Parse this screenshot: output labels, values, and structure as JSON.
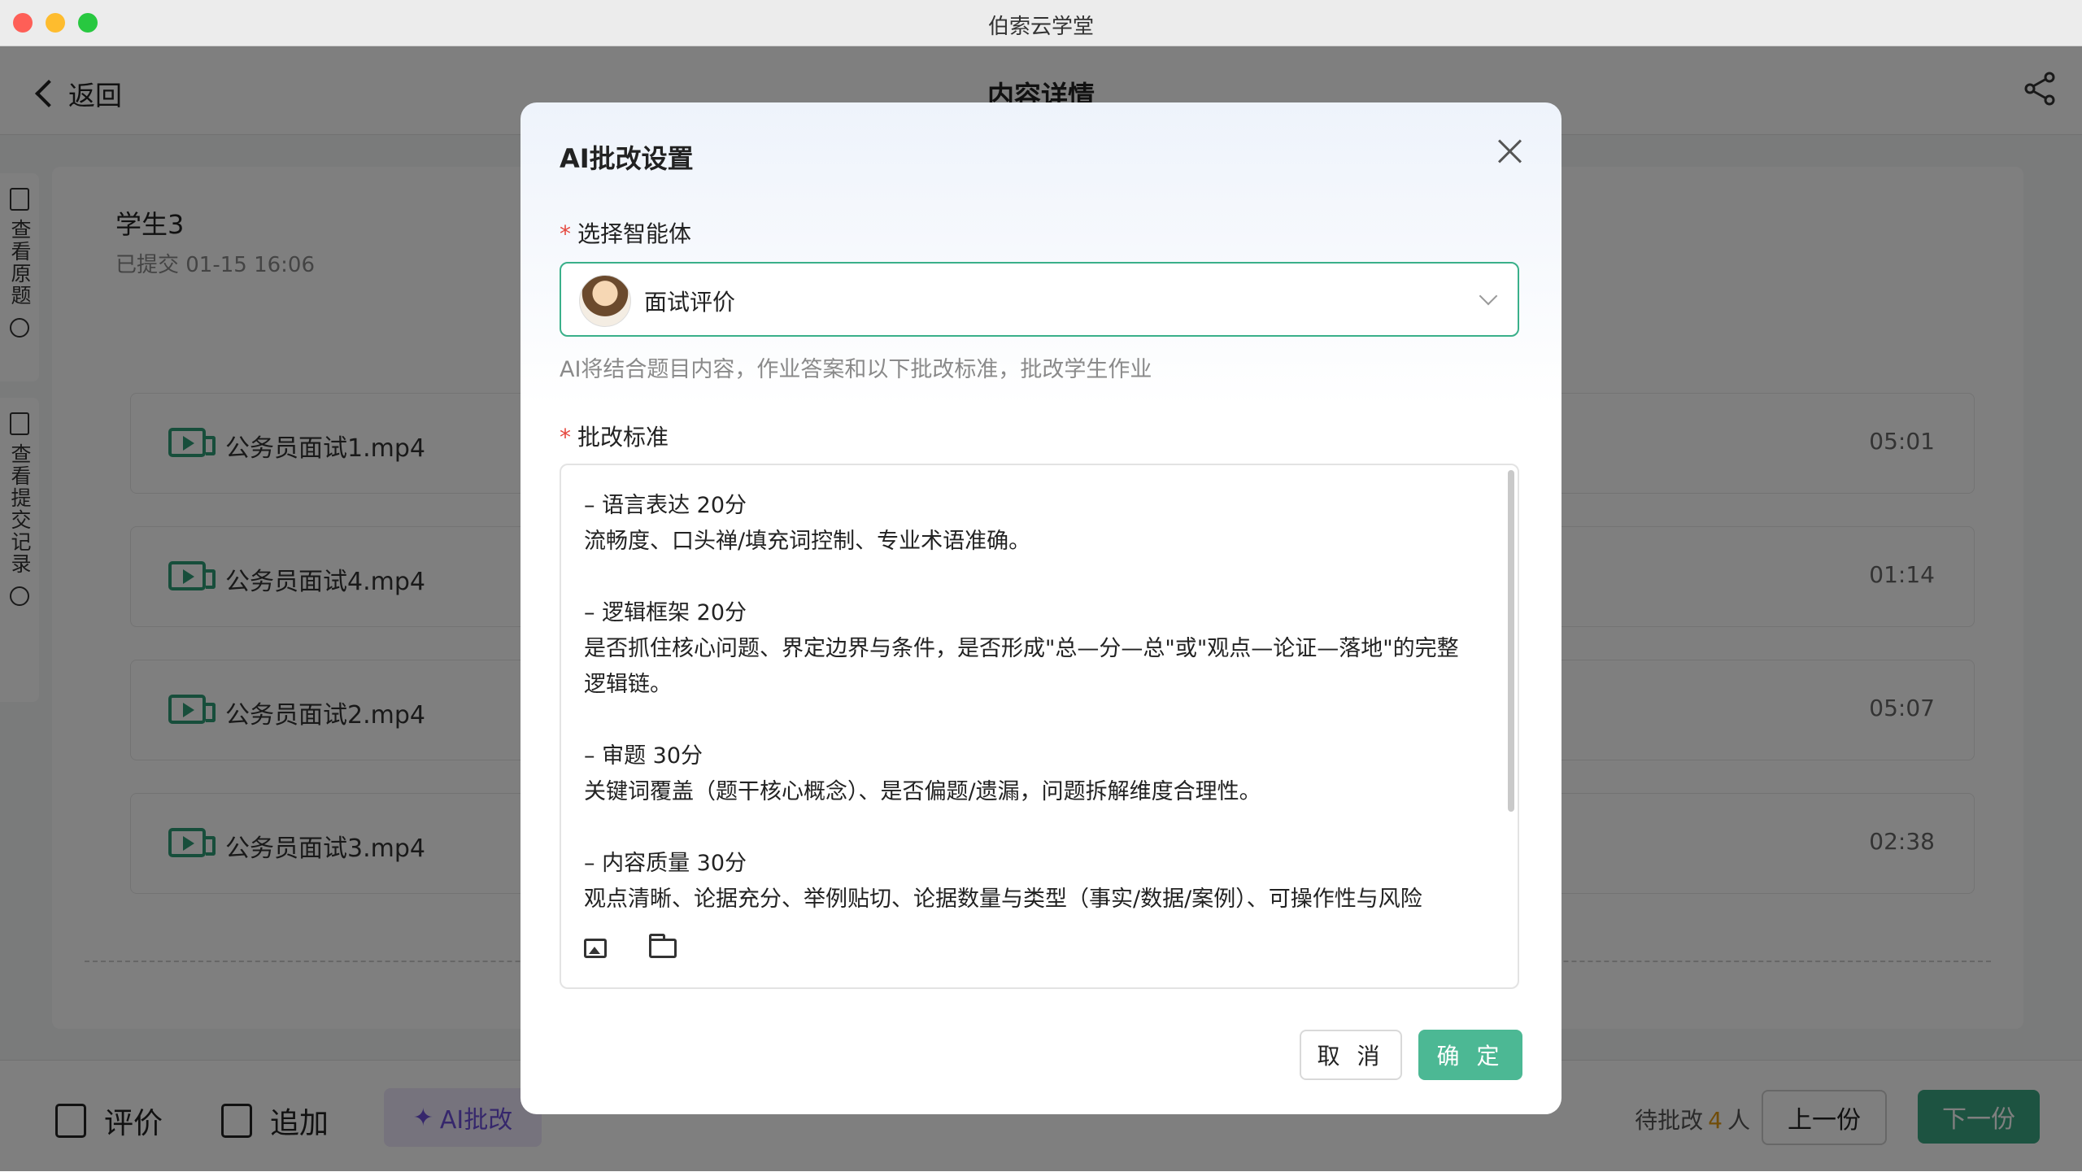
{
  "window": {
    "title": "伯索云学堂"
  },
  "nav": {
    "back_label": "返回",
    "page_title": "内容详情"
  },
  "side_tabs": [
    {
      "label": "查看原题"
    },
    {
      "label": "查看提交记录"
    }
  ],
  "submission": {
    "student": "学生3",
    "submitted": "已提交 01-15 16:06",
    "files": [
      {
        "name": "公务员面试1.mp4",
        "duration": "05:01"
      },
      {
        "name": "公务员面试4.mp4",
        "duration": "01:14"
      },
      {
        "name": "公务员面试2.mp4",
        "duration": "05:07"
      },
      {
        "name": "公务员面试3.mp4",
        "duration": "02:38"
      }
    ]
  },
  "bottom_bar": {
    "evaluate": "评价",
    "append": "追加",
    "ai_grade": "AI批改",
    "pending_prefix": "待批改",
    "pending_count": "4",
    "pending_suffix": "人",
    "prev": "上一份",
    "next": "下一份"
  },
  "modal": {
    "title": "AI批改设置",
    "agent_label": "选择智能体",
    "agent_value": "面试评价",
    "agent_hint": "AI将结合题目内容，作业答案和以下批改标准，批改学生作业",
    "criteria_label": "批改标准",
    "required_mark": "*",
    "criteria_lines": [
      "– 语言表达 20分",
      "流畅度、口头禅/填充词控制、专业术语准确。",
      "",
      "– 逻辑框架 20分",
      "是否抓住核心问题、界定边界与条件，是否形成\"总—分—总\"或\"观点—论证—落地\"的完整",
      "逻辑链。",
      "",
      "– 审题 30分",
      "关键词覆盖（题干核心概念）、是否偏题/遗漏，问题拆解维度合理性。",
      "",
      "– 内容质量 30分",
      "观点清晰、论据充分、举例贴切、论据数量与类型（事实/数据/案例）、可操作性与风险"
    ],
    "cancel": "取 消",
    "confirm": "确 定"
  },
  "colors": {
    "accent": "#3ab08a",
    "confirm": "#4cb894",
    "ai": "#6c4fd8",
    "required": "#e5483f"
  }
}
